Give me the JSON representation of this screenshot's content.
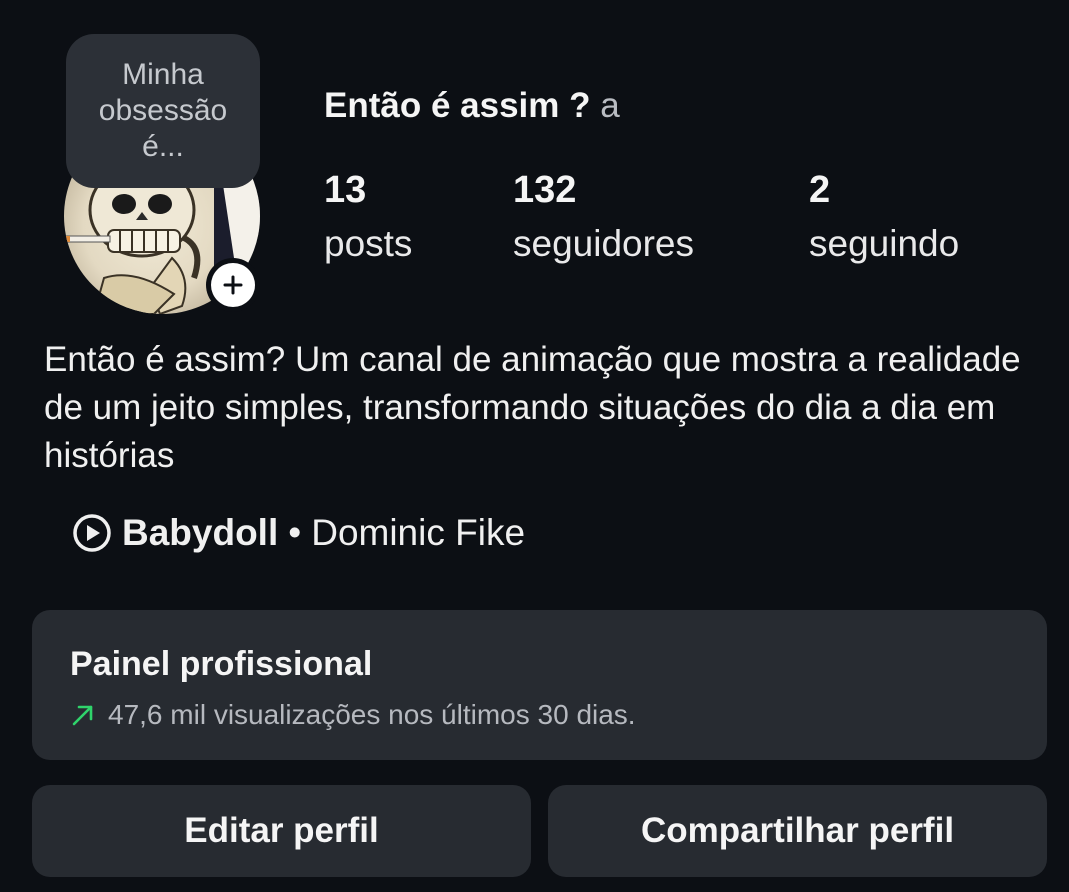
{
  "profile": {
    "note": "Minha obsessão é...",
    "name": "Então é assim ?",
    "name_suffix": "a",
    "stats": [
      {
        "value": "13",
        "label": "posts"
      },
      {
        "value": "132",
        "label": "seguidores"
      },
      {
        "value": "2",
        "label": "seguindo"
      }
    ],
    "bio": "Então é assim? Um canal de animação que mostra a realidade de um jeito simples, transformando situações do dia a dia em histórias",
    "music": {
      "song": "Babydoll",
      "separator": "•",
      "artist": "Dominic Fike",
      "icon": "play-circle-icon"
    }
  },
  "dashboard": {
    "title": "Painel profissional",
    "stat_text": "47,6 mil visualizações nos últimos 30 dias.",
    "trend_icon": "trend-up-arrow-icon",
    "trend_color": "#2fd46b"
  },
  "actions": {
    "edit_label": "Editar perfil",
    "share_label": "Compartilhar perfil"
  }
}
